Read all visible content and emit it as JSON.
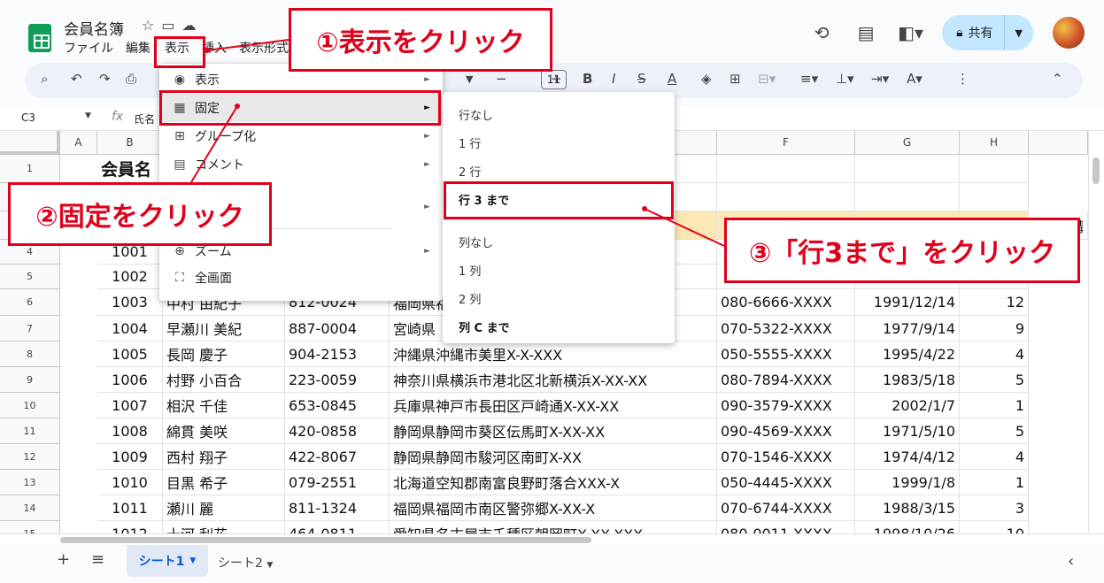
{
  "app": {
    "doc_title": "会員名簿",
    "menus": [
      "ファイル",
      "編集",
      "表示",
      "挿入",
      "表示形式"
    ],
    "share_label": "共有",
    "name_box": "C3",
    "formula_value": "氏名"
  },
  "toolbar": {
    "font_size": "11"
  },
  "grid": {
    "columns": [
      "A",
      "B",
      "C",
      "D",
      "E",
      "F",
      "G",
      "H"
    ],
    "row_numbers": [
      "1",
      "2",
      "3",
      "4",
      "5",
      "6",
      "7",
      "8",
      "9",
      "10",
      "11",
      "12",
      "13",
      "14",
      "15"
    ],
    "title_text": "会員名",
    "rows": [
      {
        "id": "1001",
        "name": "",
        "zip": "",
        "addr": "",
        "tel": "",
        "birth": "",
        "num": ""
      },
      {
        "id": "1002",
        "name": "",
        "zip": "",
        "addr": "",
        "tel": "",
        "birth": "",
        "num": ""
      },
      {
        "id": "1003",
        "name": "中村 由紀子",
        "zip": "812-0024",
        "addr": "福岡県福",
        "tel": "080-6666-XXXX",
        "birth": "1991/12/14",
        "num": "12"
      },
      {
        "id": "1004",
        "name": "早瀬川 美紀",
        "zip": "887-0004",
        "addr": "宮崎県",
        "tel": "070-5322-XXXX",
        "birth": "1977/9/14",
        "num": "9"
      },
      {
        "id": "1005",
        "name": "長岡 慶子",
        "zip": "904-2153",
        "addr": "沖縄県沖縄市美里X-X-XXX",
        "tel": "050-5555-XXXX",
        "birth": "1995/4/22",
        "num": "4"
      },
      {
        "id": "1006",
        "name": "村野 小百合",
        "zip": "223-0059",
        "addr": "神奈川県横浜市港北区北新横浜X-XX-XX",
        "tel": "080-7894-XXXX",
        "birth": "1983/5/18",
        "num": "5"
      },
      {
        "id": "1007",
        "name": "相沢 千佳",
        "zip": "653-0845",
        "addr": "兵庫県神戸市長田区戸崎通X-XX-XX",
        "tel": "090-3579-XXXX",
        "birth": "2002/1/7",
        "num": "1"
      },
      {
        "id": "1008",
        "name": "綿貫 美咲",
        "zip": "420-0858",
        "addr": "静岡県静岡市葵区伝馬町X-XX-XX",
        "tel": "090-4569-XXXX",
        "birth": "1971/5/10",
        "num": "5"
      },
      {
        "id": "1009",
        "name": "西村 翔子",
        "zip": "422-8067",
        "addr": "静岡県静岡市駿河区南町X-XX",
        "tel": "070-1546-XXXX",
        "birth": "1974/4/12",
        "num": "4"
      },
      {
        "id": "1010",
        "name": "目黒 希子",
        "zip": "079-2551",
        "addr": "北海道空知郡南富良野町落合XXX-X",
        "tel": "050-4445-XXXX",
        "birth": "1999/1/8",
        "num": "1"
      },
      {
        "id": "1011",
        "name": "瀬川 麗",
        "zip": "811-1324",
        "addr": "福岡県福岡市南区警弥郷X-XX-X",
        "tel": "070-6744-XXXX",
        "birth": "1988/3/15",
        "num": "3"
      },
      {
        "id": "1012",
        "name": "十河 利花",
        "zip": "464-0811",
        "addr": "愛知県名古屋市千種区朝岡町X-XX-XXX",
        "tel": "080-0011-XXXX",
        "birth": "1998/10/26",
        "num": "10"
      }
    ],
    "right_edge_char": "購"
  },
  "view_menu": {
    "items": [
      {
        "icon": "eye-icon",
        "label": "表示"
      },
      {
        "icon": "freeze-icon",
        "label": "固定"
      },
      {
        "icon": "group-icon",
        "label": "グループ化"
      },
      {
        "icon": "comment-icon",
        "label": "コメント"
      },
      {
        "icon": "zoom-icon",
        "label": "ズーム"
      },
      {
        "icon": "fullscreen-icon",
        "label": "全画面"
      }
    ]
  },
  "freeze_menu": {
    "items": [
      "行なし",
      "1 行",
      "2 行",
      "行 3 まで",
      "列なし",
      "1 列",
      "2 列",
      "列 C まで"
    ]
  },
  "sheets": [
    "シート1",
    "シート2"
  ],
  "annotations": {
    "step1": "①表示をクリック",
    "step2": "②固定をクリック",
    "step3": "③「行3まで」をクリック"
  },
  "colors": {
    "annotation_red": "#e0001b",
    "share_bg": "#c2e7ff",
    "logo_green": "#0f9d58"
  }
}
